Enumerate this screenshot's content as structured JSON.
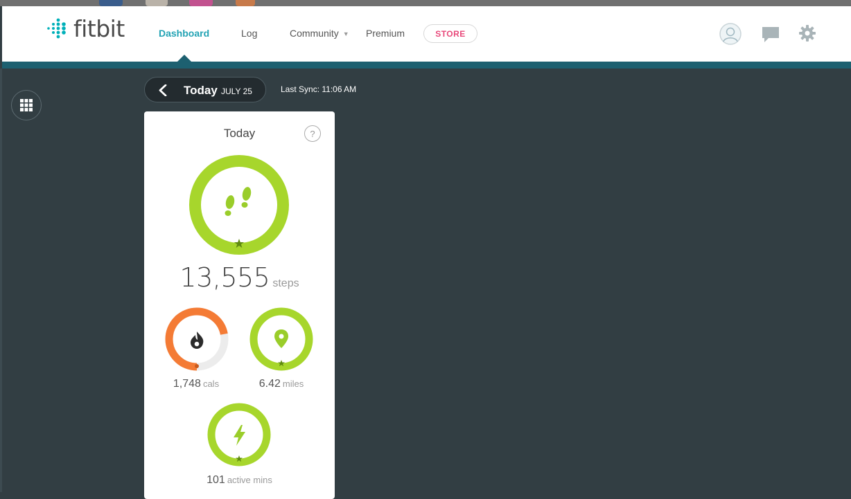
{
  "header": {
    "brand": "fitbit",
    "nav": {
      "dashboard": "Dashboard",
      "log": "Log",
      "community": "Community",
      "premium": "Premium",
      "store": "STORE"
    },
    "colors": {
      "accent": "#23a3b4",
      "bar": "#1d6070",
      "store": "#e8487a"
    }
  },
  "date_switcher": {
    "label": "Today",
    "date": "JULY 25",
    "last_sync": "Last Sync: 11:06 AM"
  },
  "tile": {
    "title": "Today",
    "help": "?",
    "steps": {
      "value": "13,555",
      "unit": "steps",
      "goal_met": true,
      "icon": "footprints-icon"
    },
    "calories": {
      "value": "1,748",
      "unit": "cals",
      "progress": 0.72,
      "icon": "flame-icon"
    },
    "distance": {
      "value": "6.42",
      "unit": "miles",
      "goal_met": true,
      "icon": "location-pin-icon"
    },
    "active": {
      "value": "101",
      "unit": "active mins",
      "goal_met": true,
      "icon": "lightning-icon"
    },
    "colors": {
      "green": "#a7d62c",
      "orange": "#f47b35",
      "track": "#ececec"
    }
  }
}
